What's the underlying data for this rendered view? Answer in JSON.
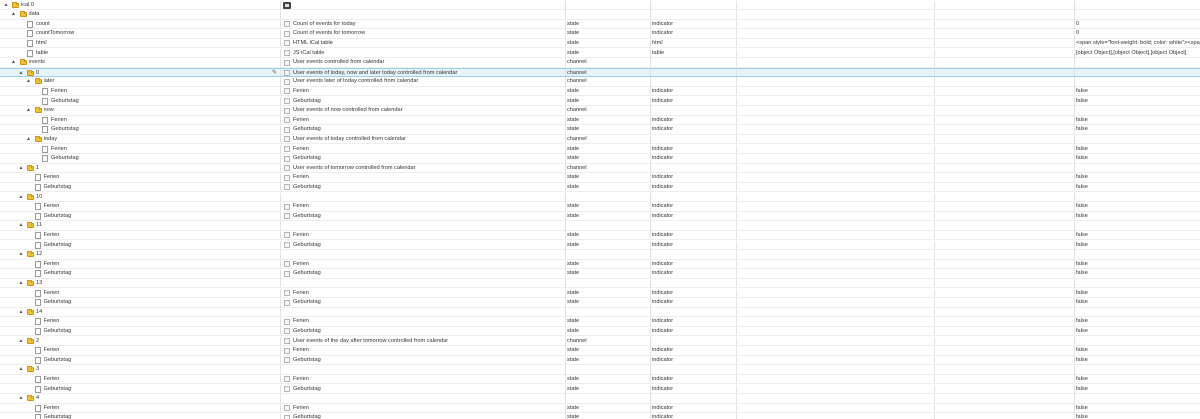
{
  "toolbar": {
    "edit_glyph": "✎"
  },
  "rows": [
    {
      "label": "ical.0",
      "type": "folder",
      "indent": 0,
      "arrow": "▲",
      "desc": "",
      "role": "",
      "kind": "",
      "value": "",
      "toolbar": true
    },
    {
      "label": "data",
      "type": "folder",
      "indent": 1,
      "arrow": "▲",
      "desc": "",
      "role": "",
      "kind": "",
      "value": ""
    },
    {
      "label": "count",
      "type": "file",
      "indent": 2,
      "desc": "Count of events for today",
      "role": "state",
      "kind": "indicator",
      "value": "0"
    },
    {
      "label": "countTomorrow",
      "type": "file",
      "indent": 2,
      "desc": "Count of events for tomorrow",
      "role": "state",
      "kind": "indicator",
      "value": "0"
    },
    {
      "label": "html",
      "type": "file",
      "indent": 2,
      "desc": "HTML iCal table",
      "role": "state",
      "kind": "html",
      "value": "<span style=\"font-weight: bold; color: white\"><span cl"
    },
    {
      "label": "table",
      "type": "file",
      "indent": 2,
      "desc": "JS iCal table",
      "role": "state",
      "kind": "table",
      "value": "[object Object],[object Object],[object Object]"
    },
    {
      "label": "events",
      "type": "folder",
      "indent": 1,
      "arrow": "▲",
      "desc": "User events controlled from calendar",
      "role": "channel",
      "kind": "",
      "value": ""
    },
    {
      "label": "0",
      "type": "folder",
      "indent": 2,
      "arrow": "▲",
      "desc": "User events of today, now and later today controlled from calendar",
      "role": "channel",
      "kind": "",
      "value": "",
      "selected": true
    },
    {
      "label": "later",
      "type": "folder",
      "indent": 3,
      "arrow": "▲",
      "desc": "User events later of today controlled from calendar",
      "role": "channel",
      "kind": "",
      "value": ""
    },
    {
      "label": "Ferien",
      "type": "file",
      "indent": 4,
      "desc": "Ferien",
      "role": "state",
      "kind": "indicator",
      "value": "false"
    },
    {
      "label": "Geburtstag",
      "type": "file",
      "indent": 4,
      "desc": "Geburtstag",
      "role": "state",
      "kind": "indicator",
      "value": "false"
    },
    {
      "label": "now",
      "type": "folder",
      "indent": 3,
      "arrow": "▲",
      "desc": "User events of now controlled from calendar",
      "role": "channel",
      "kind": "",
      "value": ""
    },
    {
      "label": "Ferien",
      "type": "file",
      "indent": 4,
      "desc": "Ferien",
      "role": "state",
      "kind": "indicator",
      "value": "false"
    },
    {
      "label": "Geburtstag",
      "type": "file",
      "indent": 4,
      "desc": "Geburtstag",
      "role": "state",
      "kind": "indicator",
      "value": "false"
    },
    {
      "label": "today",
      "type": "folder",
      "indent": 3,
      "arrow": "▲",
      "desc": "User events of today controlled from calendar",
      "role": "channel",
      "kind": "",
      "value": ""
    },
    {
      "label": "Ferien",
      "type": "file",
      "indent": 4,
      "desc": "Ferien",
      "role": "state",
      "kind": "indicator",
      "value": "false"
    },
    {
      "label": "Geburtstag",
      "type": "file",
      "indent": 4,
      "desc": "Geburtstag",
      "role": "state",
      "kind": "indicator",
      "value": "false"
    },
    {
      "label": "1",
      "type": "folder",
      "indent": 2,
      "arrow": "▲",
      "desc": "User events of tomorrow controlled from calendar",
      "role": "channel",
      "kind": "",
      "value": ""
    },
    {
      "label": "Ferien",
      "type": "file",
      "indent": 3,
      "desc": "Ferien",
      "role": "state",
      "kind": "indicator",
      "value": "false"
    },
    {
      "label": "Geburtstag",
      "type": "file",
      "indent": 3,
      "desc": "Geburtstag",
      "role": "state",
      "kind": "indicator",
      "value": "false"
    },
    {
      "label": "10",
      "type": "folder",
      "indent": 2,
      "arrow": "▲",
      "desc": "",
      "role": "",
      "kind": "",
      "value": ""
    },
    {
      "label": "Ferien",
      "type": "file",
      "indent": 3,
      "desc": "Ferien",
      "role": "state",
      "kind": "indicator",
      "value": "false"
    },
    {
      "label": "Geburtstag",
      "type": "file",
      "indent": 3,
      "desc": "Geburtstag",
      "role": "state",
      "kind": "indicator",
      "value": "false"
    },
    {
      "label": "11",
      "type": "folder",
      "indent": 2,
      "arrow": "▲",
      "desc": "",
      "role": "",
      "kind": "",
      "value": ""
    },
    {
      "label": "Ferien",
      "type": "file",
      "indent": 3,
      "desc": "Ferien",
      "role": "state",
      "kind": "indicator",
      "value": "false"
    },
    {
      "label": "Geburtstag",
      "type": "file",
      "indent": 3,
      "desc": "Geburtstag",
      "role": "state",
      "kind": "indicator",
      "value": "false"
    },
    {
      "label": "12",
      "type": "folder",
      "indent": 2,
      "arrow": "▲",
      "desc": "",
      "role": "",
      "kind": "",
      "value": ""
    },
    {
      "label": "Ferien",
      "type": "file",
      "indent": 3,
      "desc": "Ferien",
      "role": "state",
      "kind": "indicator",
      "value": "false"
    },
    {
      "label": "Geburtstag",
      "type": "file",
      "indent": 3,
      "desc": "Geburtstag",
      "role": "state",
      "kind": "indicator",
      "value": "false"
    },
    {
      "label": "13",
      "type": "folder",
      "indent": 2,
      "arrow": "▲",
      "desc": "",
      "role": "",
      "kind": "",
      "value": ""
    },
    {
      "label": "Ferien",
      "type": "file",
      "indent": 3,
      "desc": "Ferien",
      "role": "state",
      "kind": "indicator",
      "value": "false"
    },
    {
      "label": "Geburtstag",
      "type": "file",
      "indent": 3,
      "desc": "Geburtstag",
      "role": "state",
      "kind": "indicator",
      "value": "false"
    },
    {
      "label": "14",
      "type": "folder",
      "indent": 2,
      "arrow": "▲",
      "desc": "",
      "role": "",
      "kind": "",
      "value": ""
    },
    {
      "label": "Ferien",
      "type": "file",
      "indent": 3,
      "desc": "Ferien",
      "role": "state",
      "kind": "indicator",
      "value": "false"
    },
    {
      "label": "Geburtstag",
      "type": "file",
      "indent": 3,
      "desc": "Geburtstag",
      "role": "state",
      "kind": "indicator",
      "value": "false"
    },
    {
      "label": "2",
      "type": "folder",
      "indent": 2,
      "arrow": "▲",
      "desc": "User events of the day after tomorrow controlled from calendar",
      "role": "channel",
      "kind": "",
      "value": ""
    },
    {
      "label": "Ferien",
      "type": "file",
      "indent": 3,
      "desc": "Ferien",
      "role": "state",
      "kind": "indicator",
      "value": "false"
    },
    {
      "label": "Geburtstag",
      "type": "file",
      "indent": 3,
      "desc": "Geburtstag",
      "role": "state",
      "kind": "indicator",
      "value": "false"
    },
    {
      "label": "3",
      "type": "folder",
      "indent": 2,
      "arrow": "▲",
      "desc": "",
      "role": "",
      "kind": "",
      "value": ""
    },
    {
      "label": "Ferien",
      "type": "file",
      "indent": 3,
      "desc": "Ferien",
      "role": "state",
      "kind": "indicator",
      "value": "false"
    },
    {
      "label": "Geburtstag",
      "type": "file",
      "indent": 3,
      "desc": "Geburtstag",
      "role": "state",
      "kind": "indicator",
      "value": "false"
    },
    {
      "label": "4",
      "type": "folder",
      "indent": 2,
      "arrow": "▲",
      "desc": "",
      "role": "",
      "kind": "",
      "value": ""
    },
    {
      "label": "Ferien",
      "type": "file",
      "indent": 3,
      "desc": "Ferien",
      "role": "state",
      "kind": "indicator",
      "value": "false"
    },
    {
      "label": "Geburtstag",
      "type": "file",
      "indent": 3,
      "desc": "Geburtstag",
      "role": "state",
      "kind": "indicator",
      "value": "false"
    }
  ]
}
